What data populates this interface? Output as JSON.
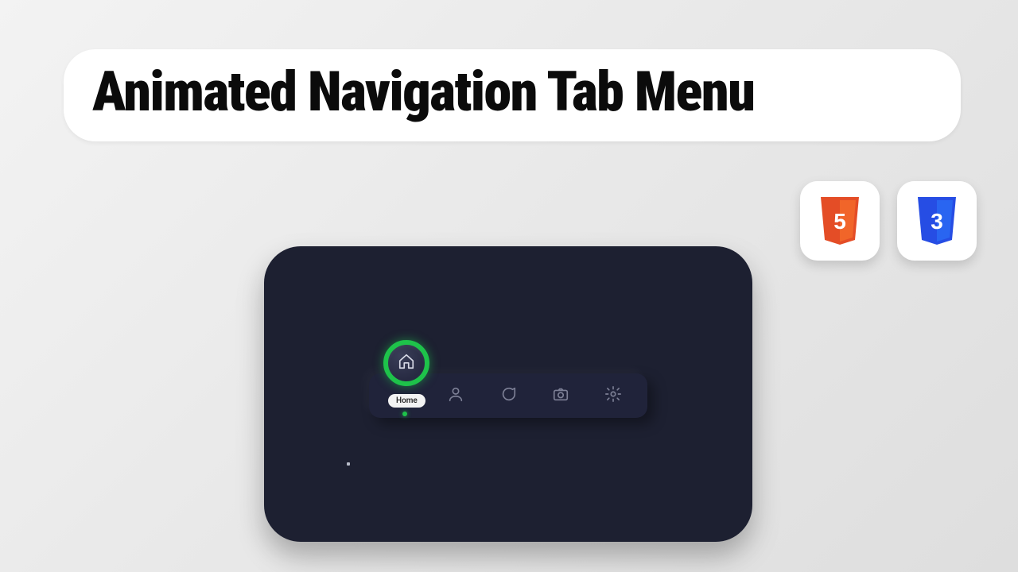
{
  "title": "Animated Navigation Tab Menu",
  "badges": {
    "html5": {
      "glyph": "5",
      "fill": "#e44d26",
      "inner": "#f16529"
    },
    "css3": {
      "glyph": "3",
      "fill": "#264de4",
      "inner": "#2965f1"
    }
  },
  "nav": {
    "active_index": 0,
    "items": [
      {
        "id": "home",
        "label": "Home",
        "icon": "home-icon"
      },
      {
        "id": "profile",
        "label": "Profile",
        "icon": "user-icon"
      },
      {
        "id": "chat",
        "label": "Chat",
        "icon": "chat-icon"
      },
      {
        "id": "camera",
        "label": "Camera",
        "icon": "camera-icon"
      },
      {
        "id": "settings",
        "label": "Settings",
        "icon": "gear-icon"
      }
    ]
  },
  "colors": {
    "panel_bg": "#1d2031",
    "navbar_bg": "#20233a",
    "icon_muted": "#7d8096",
    "accent_green": "#1ec24a"
  }
}
